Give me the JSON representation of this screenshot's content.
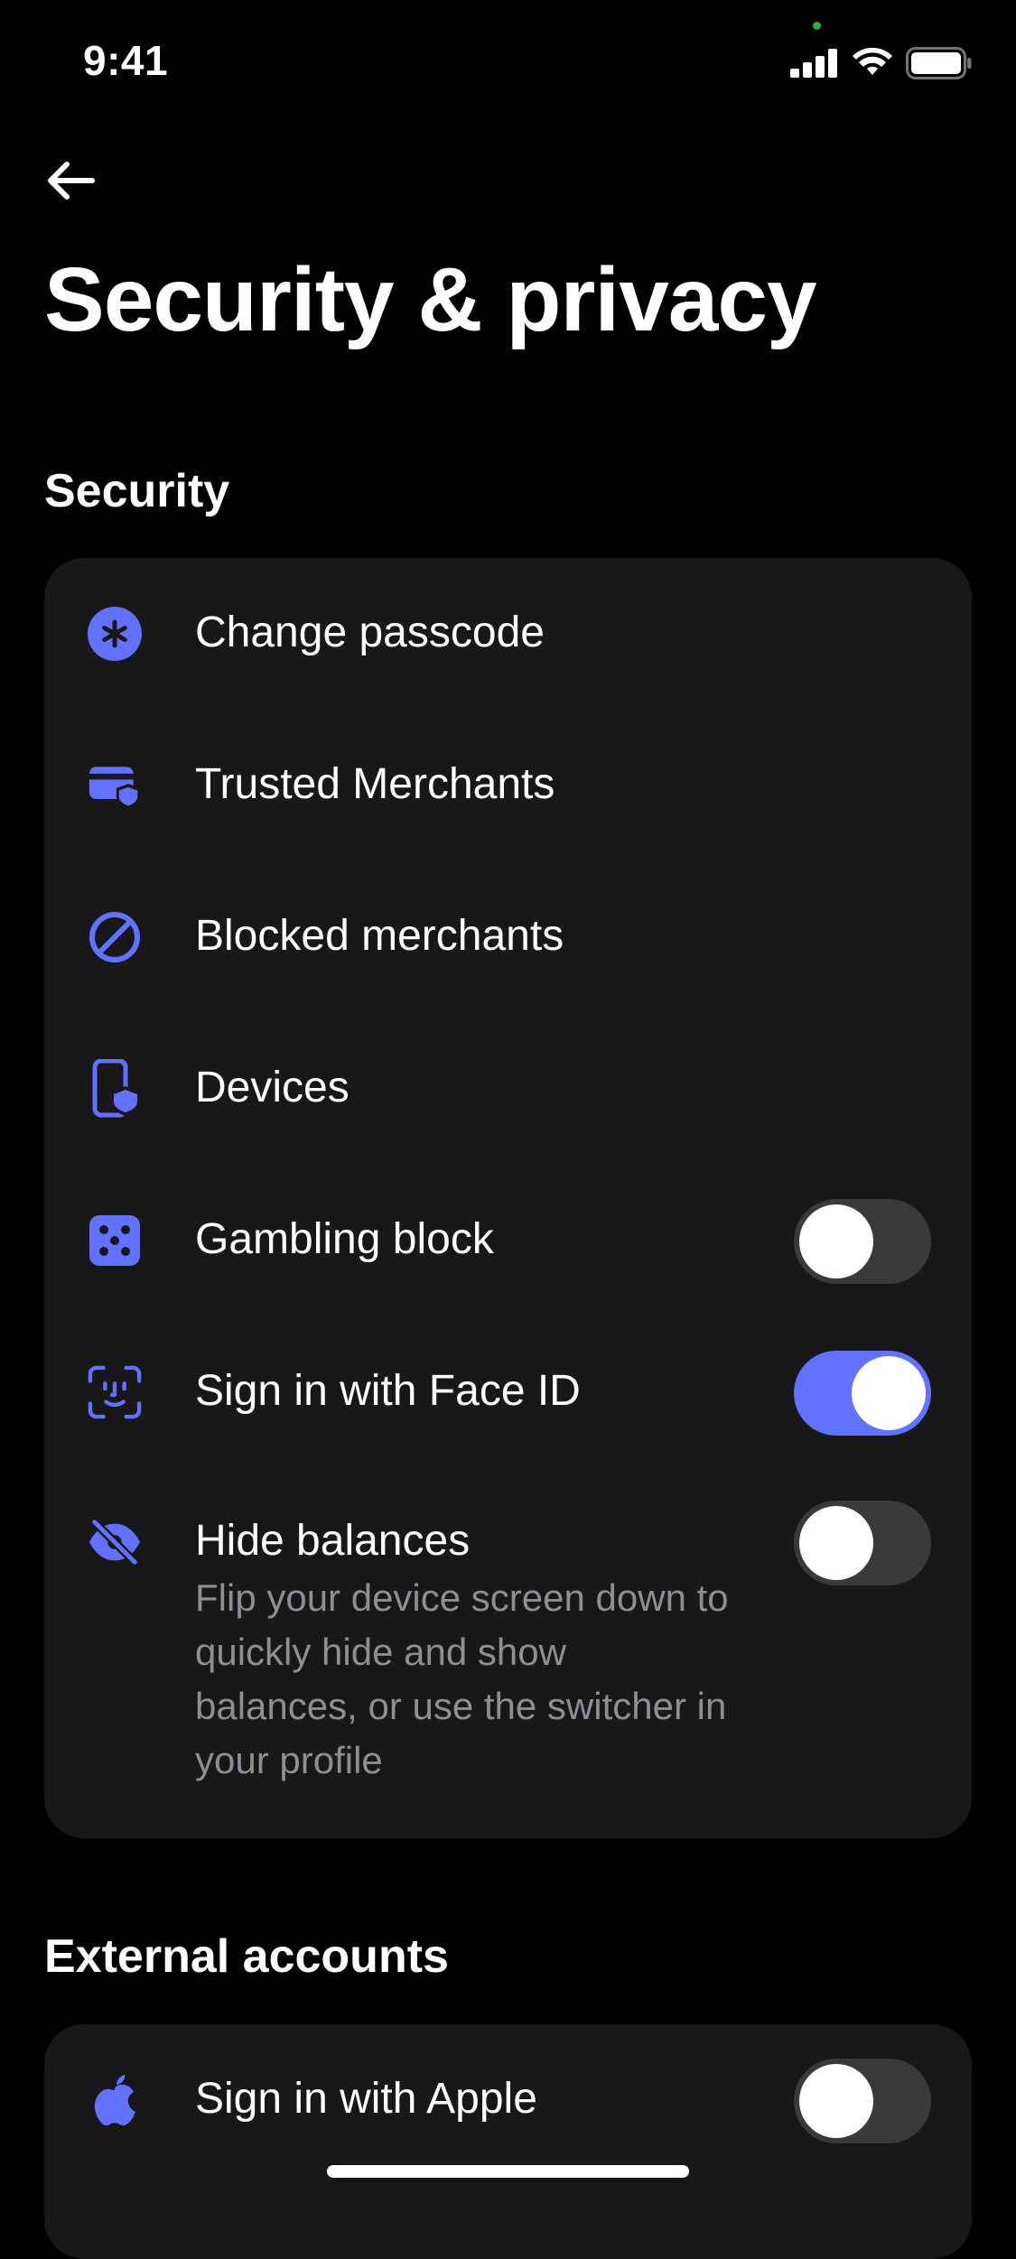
{
  "status_bar": {
    "time": "9:41"
  },
  "page": {
    "title": "Security & privacy"
  },
  "colors": {
    "accent": "#6271ff",
    "card": "#18181b",
    "background": "#000000",
    "secondary_text": "#8e8e93",
    "toggle_off": "#3a3a3d"
  },
  "security": {
    "title": "Security",
    "items": [
      {
        "label": "Change passcode",
        "icon": "asterisk-icon"
      },
      {
        "label": "Trusted Merchants",
        "icon": "card-shield-icon"
      },
      {
        "label": "Blocked merchants",
        "icon": "block-icon"
      },
      {
        "label": "Devices",
        "icon": "phone-shield-icon"
      },
      {
        "label": "Gambling block",
        "icon": "dice-icon",
        "toggle": false
      },
      {
        "label": "Sign in with Face ID",
        "icon": "face-id-icon",
        "toggle": true
      },
      {
        "label": "Hide balances",
        "icon": "eye-slash-icon",
        "toggle": false,
        "description": "Flip your device screen down to quickly hide and show balances, or use the switcher in your profile"
      }
    ]
  },
  "external": {
    "title": "External accounts",
    "items": [
      {
        "label": "Sign in with Apple",
        "icon": "apple-icon",
        "toggle": false
      }
    ]
  }
}
